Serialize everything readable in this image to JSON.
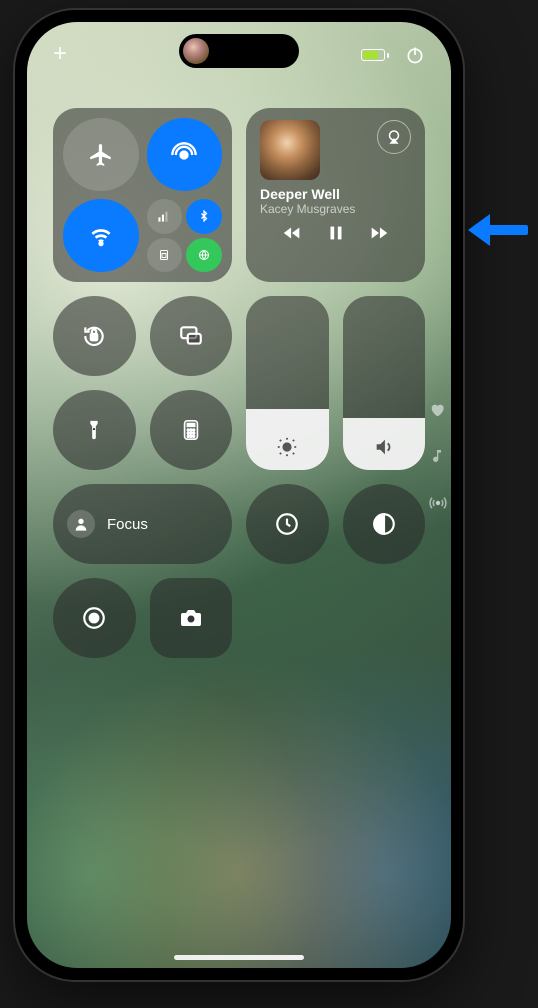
{
  "status": {
    "add_label": "+",
    "battery_pct": 70
  },
  "connectivity": {
    "airplane_on": false,
    "airdrop_on": true,
    "wifi_on": true,
    "cellular_on": false,
    "bluetooth_on": true,
    "personal_hotspot_on": true
  },
  "now_playing": {
    "title": "Deeper Well",
    "artist": "Kacey Musgraves"
  },
  "tiles": {
    "orientation_lock": "Orientation Lock",
    "screen_mirroring": "Screen Mirroring",
    "flashlight": "Flashlight",
    "calculator": "Calculator",
    "timer": "Timer",
    "dark_mode": "Dark Mode",
    "screen_record": "Screen Record",
    "camera": "Camera"
  },
  "focus": {
    "label": "Focus"
  },
  "sliders": {
    "brightness": 0.35,
    "volume": 0.3
  },
  "rail": {
    "items": [
      "favorites",
      "music",
      "broadcast"
    ]
  }
}
